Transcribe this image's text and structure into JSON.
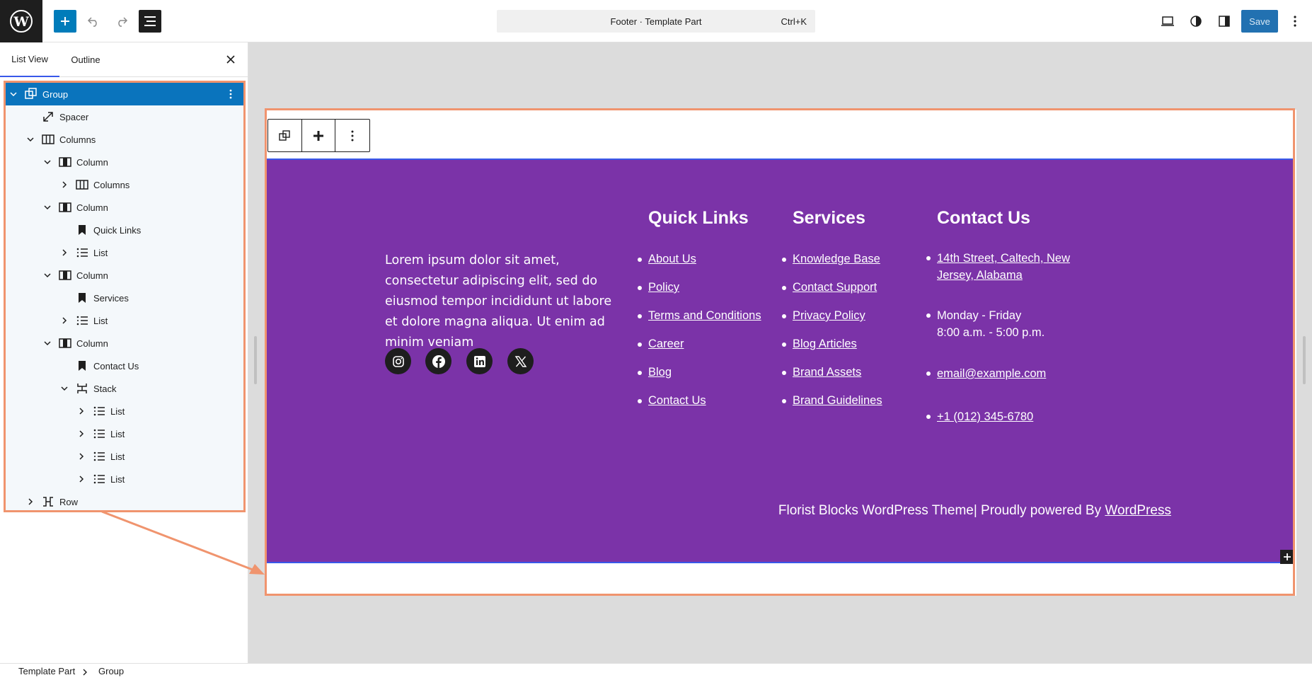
{
  "header": {
    "document_title": "Footer · Template Part",
    "shortcut": "Ctrl+K",
    "save_label": "Save"
  },
  "sidebar": {
    "tabs": [
      {
        "label": "List View",
        "active": true
      },
      {
        "label": "Outline",
        "active": false
      }
    ],
    "tree": [
      {
        "label": "Group",
        "icon": "group-icon",
        "expanded": true,
        "selected": true,
        "depth": 0
      },
      {
        "label": "Spacer",
        "icon": "spacer-icon",
        "depth": 1
      },
      {
        "label": "Columns",
        "icon": "columns-icon",
        "expanded": true,
        "depth": 1
      },
      {
        "label": "Column",
        "icon": "column-icon",
        "expanded": true,
        "depth": 2
      },
      {
        "label": "Columns",
        "icon": "columns-icon",
        "expanded": false,
        "depth": 3
      },
      {
        "label": "Column",
        "icon": "column-icon",
        "expanded": true,
        "depth": 2
      },
      {
        "label": "Quick Links",
        "icon": "bookmark-icon",
        "depth": 3
      },
      {
        "label": "List",
        "icon": "list-icon",
        "expanded": false,
        "depth": 3
      },
      {
        "label": "Column",
        "icon": "column-icon",
        "expanded": true,
        "depth": 2
      },
      {
        "label": "Services",
        "icon": "bookmark-icon",
        "depth": 3
      },
      {
        "label": "List",
        "icon": "list-icon",
        "expanded": false,
        "depth": 3
      },
      {
        "label": "Column",
        "icon": "column-icon",
        "expanded": true,
        "depth": 2
      },
      {
        "label": "Contact Us",
        "icon": "bookmark-icon",
        "depth": 3
      },
      {
        "label": "Stack",
        "icon": "stack-icon",
        "expanded": true,
        "depth": 3
      },
      {
        "label": "List",
        "icon": "list-icon",
        "expanded": false,
        "depth": 4
      },
      {
        "label": "List",
        "icon": "list-icon",
        "expanded": false,
        "depth": 4
      },
      {
        "label": "List",
        "icon": "list-icon",
        "expanded": false,
        "depth": 4
      },
      {
        "label": "List",
        "icon": "list-icon",
        "expanded": false,
        "depth": 4
      },
      {
        "label": "Row",
        "icon": "row-icon",
        "expanded": false,
        "depth": 1
      }
    ]
  },
  "footer": {
    "about_text": "Lorem ipsum dolor sit amet, consectetur adipiscing elit, sed do eiusmod tempor incididunt ut labore et dolore magna aliqua. Ut enim ad minim veniam",
    "socials": [
      "instagram-icon",
      "facebook-icon",
      "linkedin-icon",
      "x-icon"
    ],
    "quick_links": {
      "title": "Quick Links",
      "items": [
        "About Us",
        "Policy",
        "Terms and Conditions",
        "Career",
        "Blog",
        "Contact Us"
      ]
    },
    "services": {
      "title": "Services",
      "items": [
        "Knowledge Base",
        "Contact Support",
        "Privacy Policy",
        "Blog Articles",
        "Brand Assets",
        "Brand Guidelines"
      ]
    },
    "contact": {
      "title": "Contact Us",
      "address_line1": "14th Street, Caltech, New",
      "address_line2": "Jersey, Alabama",
      "hours_line1": "Monday - Friday",
      "hours_line2": "8:00 a.m. - 5:00 p.m.",
      "email": "email@example.com",
      "phone": "+1 (012) 345-6780"
    },
    "credit_text": "Florist Blocks WordPress Theme| Proudly powered By ",
    "credit_link": "WordPress",
    "background": "#7b33a8"
  },
  "breadcrumb": {
    "items": [
      "Template Part",
      "Group"
    ]
  },
  "colors": {
    "accent": "#007cba",
    "selection": "#0a74bd",
    "annotation": "#f0946e"
  }
}
